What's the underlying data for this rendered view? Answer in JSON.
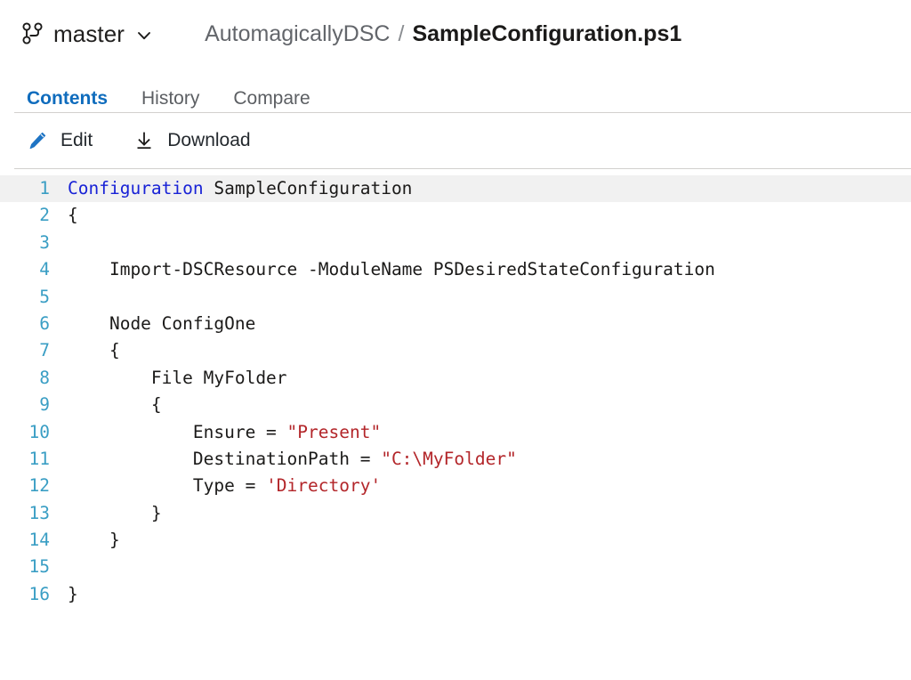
{
  "header": {
    "branch_icon": "git-branch-icon",
    "branch_name": "master",
    "branch_chevron_icon": "chevron-down-icon",
    "breadcrumb": {
      "repo": "AutomagicallyDSC",
      "separator": "/",
      "file": "SampleConfiguration.ps1"
    }
  },
  "tabs": [
    {
      "label": "Contents",
      "active": true
    },
    {
      "label": "History",
      "active": false
    },
    {
      "label": "Compare",
      "active": false
    }
  ],
  "toolbar": {
    "edit": {
      "label": "Edit",
      "icon": "pencil-icon",
      "color": "#0f6cbd"
    },
    "download": {
      "label": "Download",
      "icon": "download-icon",
      "color": "#1b1a19"
    }
  },
  "code": {
    "language": "powershell",
    "highlighted_line": 1,
    "lines": [
      {
        "n": "1",
        "segments": [
          {
            "t": "Configuration",
            "c": "kw"
          },
          {
            "t": " SampleConfiguration",
            "c": ""
          }
        ]
      },
      {
        "n": "2",
        "segments": [
          {
            "t": "{",
            "c": ""
          }
        ]
      },
      {
        "n": "3",
        "segments": [
          {
            "t": "",
            "c": ""
          }
        ]
      },
      {
        "n": "4",
        "segments": [
          {
            "t": "    Import-DSCResource -ModuleName PSDesiredStateConfiguration",
            "c": ""
          }
        ]
      },
      {
        "n": "5",
        "segments": [
          {
            "t": "",
            "c": ""
          }
        ]
      },
      {
        "n": "6",
        "segments": [
          {
            "t": "    Node ConfigOne",
            "c": ""
          }
        ]
      },
      {
        "n": "7",
        "segments": [
          {
            "t": "    {",
            "c": ""
          }
        ]
      },
      {
        "n": "8",
        "segments": [
          {
            "t": "        File MyFolder",
            "c": ""
          }
        ]
      },
      {
        "n": "9",
        "segments": [
          {
            "t": "        {",
            "c": ""
          }
        ]
      },
      {
        "n": "10",
        "segments": [
          {
            "t": "            Ensure = ",
            "c": ""
          },
          {
            "t": "\"Present\"",
            "c": "str"
          }
        ]
      },
      {
        "n": "11",
        "segments": [
          {
            "t": "            DestinationPath = ",
            "c": ""
          },
          {
            "t": "\"C:\\MyFolder\"",
            "c": "str"
          }
        ]
      },
      {
        "n": "12",
        "segments": [
          {
            "t": "            Type = ",
            "c": ""
          },
          {
            "t": "'Directory'",
            "c": "str"
          }
        ]
      },
      {
        "n": "13",
        "segments": [
          {
            "t": "        }",
            "c": ""
          }
        ]
      },
      {
        "n": "14",
        "segments": [
          {
            "t": "    }",
            "c": ""
          }
        ]
      },
      {
        "n": "15",
        "segments": [
          {
            "t": "",
            "c": ""
          }
        ]
      },
      {
        "n": "16",
        "segments": [
          {
            "t": "}",
            "c": ""
          }
        ]
      }
    ]
  },
  "colors": {
    "accent": "#0f6cbd",
    "keyword": "#1822d6",
    "string": "#b3262a",
    "line_number": "#3a9ec4",
    "divider": "#d2d0ce",
    "line_highlight": "#f1f1f1"
  }
}
